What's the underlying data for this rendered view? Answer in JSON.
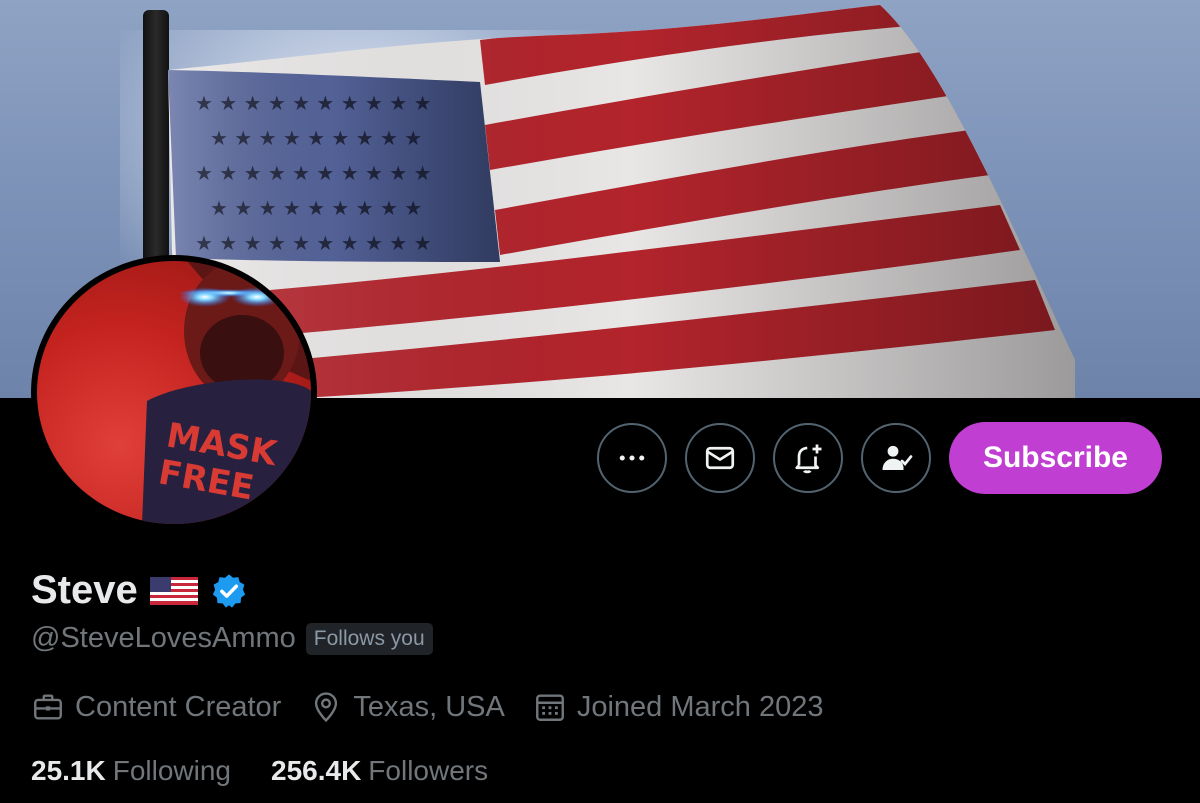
{
  "profile": {
    "display_name": "Steve",
    "handle": "@SteveLovesAmmo",
    "follows_you": "Follows you",
    "flag_emoji": "us-flag-emoji",
    "verified_icon": "verified-badge-icon"
  },
  "actions": {
    "more_icon": "more-horizontal-icon",
    "message_icon": "envelope-icon",
    "notify_icon": "bell-plus-icon",
    "following_icon": "person-check-icon",
    "subscribe_label": "Subscribe"
  },
  "meta": {
    "category": "Content Creator",
    "location": "Texas, USA",
    "joined": "Joined March 2023"
  },
  "stats": {
    "following_count": "25.1K",
    "following_label": "Following",
    "followers_count": "256.4K",
    "followers_label": "Followers"
  },
  "avatar_shirt_text": "MASK FREE",
  "colors": {
    "accent_subscribe": "#c03ed1",
    "verified_blue": "#1d9bf0",
    "muted_text": "#71767b",
    "background": "#000000"
  }
}
